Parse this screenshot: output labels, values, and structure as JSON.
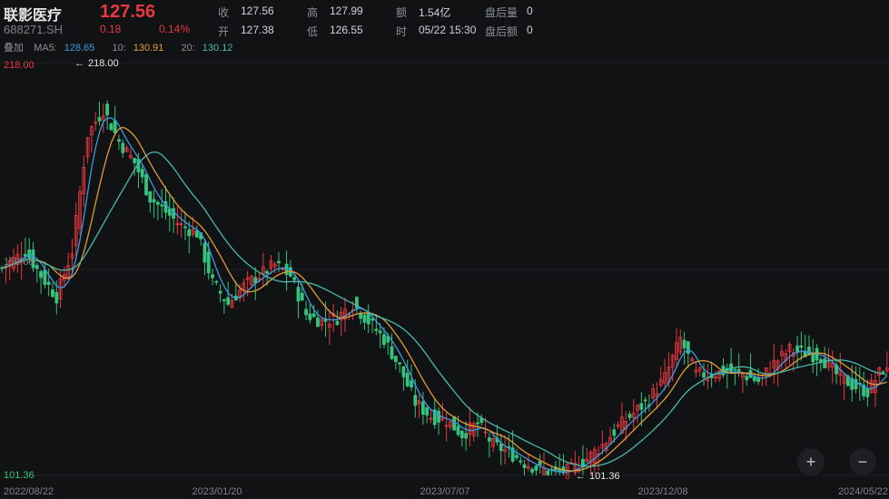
{
  "header": {
    "name": "联影医疗",
    "code": "688271.SH",
    "price": "127.56",
    "change": "0.18",
    "change_pct": "0.14%",
    "quote": [
      {
        "label": "收",
        "value": "127.56"
      },
      {
        "label": "开",
        "value": "127.38"
      },
      {
        "label": "高",
        "value": "127.99"
      },
      {
        "label": "低",
        "value": "126.55"
      },
      {
        "label": "额",
        "value": "1.54亿"
      },
      {
        "label": "时",
        "value": "05/22 15:30"
      },
      {
        "label": "盘后量",
        "value": "0"
      },
      {
        "label": "盘后额",
        "value": "0"
      }
    ]
  },
  "indicators": {
    "overlay": "叠加",
    "ma5_label": "MA5:",
    "ma5_value": "128.65",
    "ma10_label": "10:",
    "ma10_value": "130.91",
    "ma20_label": "20:",
    "ma20_value": "130.12"
  },
  "colors": {
    "up": "#e8393f",
    "down": "#35c27c",
    "ma5": "#3b9be0",
    "ma10": "#e39a3a",
    "ma20": "#48b9a9",
    "background": "#111214"
  },
  "zoom": {
    "in_icon": "plus-icon",
    "out_icon": "minus-icon"
  },
  "chart_data": {
    "type": "candlestick",
    "y_max_label": "218.00",
    "y_mid_label": "159.68",
    "y_min_label": "101.36",
    "ylim": [
      101.36,
      218.0
    ],
    "high_marker": "218.00",
    "low_marker": "101.36",
    "x_ticks": [
      "2022/08/22",
      "2023/01/20",
      "2023/07/07",
      "2023/12/08",
      "2024/05/22"
    ],
    "close_path": [
      [
        0,
        160
      ],
      [
        6,
        165
      ],
      [
        10,
        158
      ],
      [
        14,
        152
      ],
      [
        18,
        165
      ],
      [
        22,
        198
      ],
      [
        26,
        205
      ],
      [
        30,
        196
      ],
      [
        34,
        190
      ],
      [
        38,
        180
      ],
      [
        42,
        176
      ],
      [
        46,
        172
      ],
      [
        50,
        170
      ],
      [
        54,
        156
      ],
      [
        58,
        150
      ],
      [
        62,
        155
      ],
      [
        66,
        158
      ],
      [
        70,
        161
      ],
      [
        74,
        158
      ],
      [
        78,
        147
      ],
      [
        82,
        145
      ],
      [
        86,
        146
      ],
      [
        90,
        150
      ],
      [
        94,
        145
      ],
      [
        98,
        140
      ],
      [
        102,
        132
      ],
      [
        106,
        122
      ],
      [
        110,
        118
      ],
      [
        114,
        117
      ],
      [
        118,
        113
      ],
      [
        122,
        116
      ],
      [
        126,
        110
      ],
      [
        130,
        108
      ],
      [
        134,
        105
      ],
      [
        138,
        103
      ],
      [
        142,
        102
      ],
      [
        146,
        103
      ],
      [
        150,
        106
      ],
      [
        154,
        110
      ],
      [
        158,
        115
      ],
      [
        162,
        119
      ],
      [
        166,
        123
      ],
      [
        170,
        129
      ],
      [
        174,
        140
      ],
      [
        178,
        130
      ],
      [
        182,
        130
      ],
      [
        186,
        131
      ],
      [
        190,
        130
      ],
      [
        194,
        128
      ],
      [
        198,
        133
      ],
      [
        202,
        137
      ],
      [
        206,
        136
      ],
      [
        210,
        135
      ],
      [
        214,
        130
      ],
      [
        218,
        127
      ],
      [
        222,
        125
      ],
      [
        226,
        132
      ],
      [
        228,
        129
      ]
    ],
    "x_total": 228
  }
}
